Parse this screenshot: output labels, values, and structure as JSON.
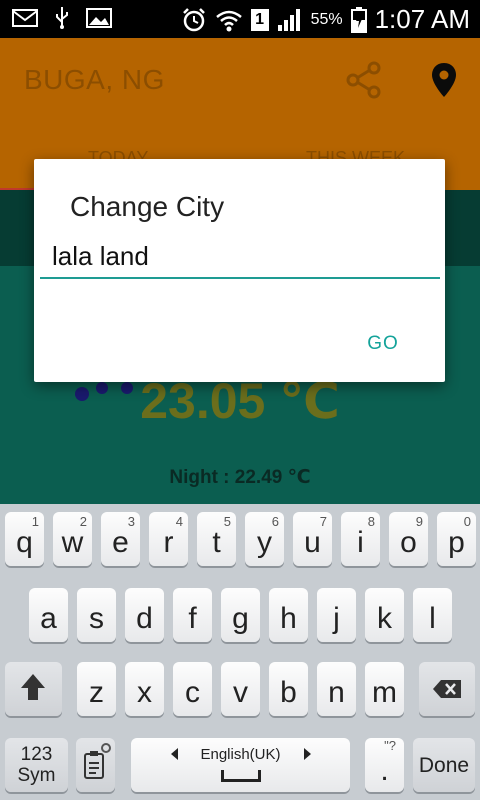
{
  "statusbar": {
    "battery": "55%",
    "sim_badge": "1",
    "time": "1:07 AM"
  },
  "app": {
    "title": "BUGA, NG",
    "tabs": [
      {
        "label": "TODAY"
      },
      {
        "label": "THIS WEEK"
      }
    ],
    "temperature": "23.05 ℃",
    "night": "Night : 22.49 ℃",
    "colors": {
      "appbar": "#b56400",
      "content": "#0b5e50",
      "accent": "#14a39a"
    }
  },
  "dialog": {
    "title": "Change City",
    "input_value": "lala land",
    "go_label": "GO"
  },
  "keyboard": {
    "row1": [
      {
        "key": "q",
        "num": "1"
      },
      {
        "key": "w",
        "num": "2"
      },
      {
        "key": "e",
        "num": "3"
      },
      {
        "key": "r",
        "num": "4"
      },
      {
        "key": "t",
        "num": "5"
      },
      {
        "key": "y",
        "num": "6"
      },
      {
        "key": "u",
        "num": "7"
      },
      {
        "key": "i",
        "num": "8"
      },
      {
        "key": "o",
        "num": "9"
      },
      {
        "key": "p",
        "num": "0"
      }
    ],
    "row2": [
      "a",
      "s",
      "d",
      "f",
      "g",
      "h",
      "j",
      "k",
      "l"
    ],
    "row3": [
      "z",
      "x",
      "c",
      "v",
      "b",
      "n",
      "m"
    ],
    "sym_line1": "123",
    "sym_line2": "Sym",
    "language": "English(UK)",
    "dot": ".",
    "dot_extra": "\"?",
    "done": "Done",
    "icons": {
      "shift": "shift-arrow-icon",
      "backspace": "backspace-icon",
      "clipboard": "clipboard-settings-icon",
      "left": "arrow-left-icon",
      "right": "arrow-right-icon"
    }
  }
}
